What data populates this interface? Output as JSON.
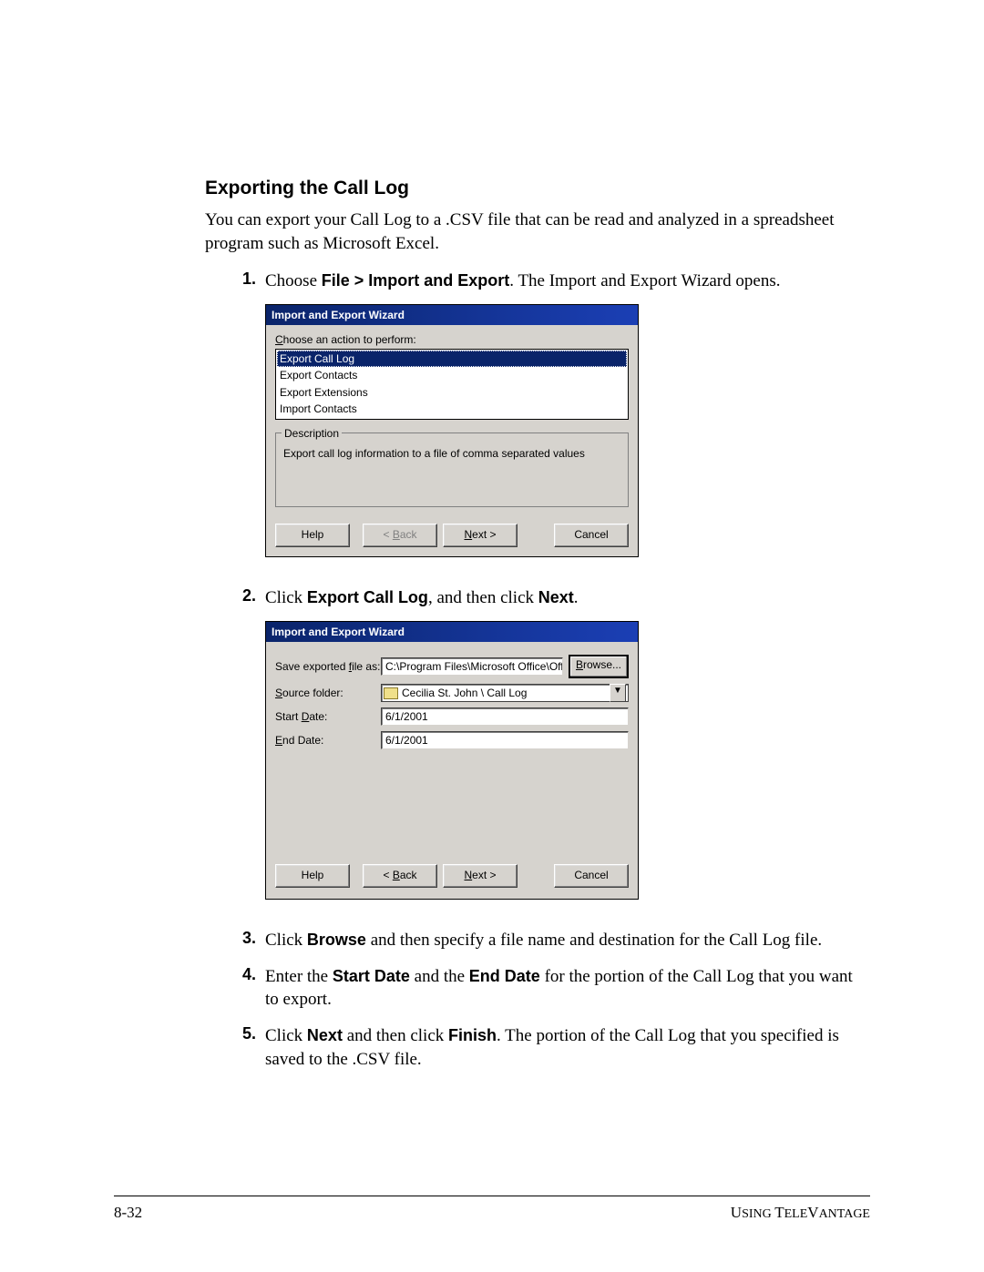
{
  "heading": "Exporting the Call Log",
  "intro": "You can export your Call Log to a .CSV file that can be read and analyzed in a spreadsheet program such as Microsoft Excel.",
  "steps": {
    "s1": {
      "num": "1.",
      "pre": "Choose ",
      "bold1": "File > Import and Export",
      "post1": ". The Import and Export Wizard opens."
    },
    "s2": {
      "num": "2.",
      "pre": "Click ",
      "bold1": "Export Call Log",
      "mid": ", and then click ",
      "bold2": "Next",
      "post": "."
    },
    "s3": {
      "num": "3.",
      "pre": "Click ",
      "bold1": "Browse",
      "post": " and then specify a file name and destination for the Call Log file."
    },
    "s4": {
      "num": "4.",
      "pre": "Enter the ",
      "bold1": "Start Date",
      "mid": " and the ",
      "bold2": "End Date",
      "post": " for the portion of the Call Log that you want to export."
    },
    "s5": {
      "num": "5.",
      "pre": "Click ",
      "bold1": "Next",
      "mid": " and then click ",
      "bold2": "Finish",
      "post": ". The portion of the Call Log that you specified is saved to the .CSV file."
    }
  },
  "dialog1": {
    "title": "Import and Export Wizard",
    "prompt": "Choose an action to perform:",
    "items": [
      "Export Call Log",
      "Export Contacts",
      "Export Extensions",
      "Import Contacts"
    ],
    "desc_legend": "Description",
    "desc_text": "Export call log information to a file of comma separated values",
    "btn_help": "Help",
    "btn_back": "< Back",
    "btn_next": "Next >",
    "btn_cancel": "Cancel",
    "next_ul": "N",
    "back_ul": "B"
  },
  "dialog2": {
    "title": "Import and Export Wizard",
    "lab_saveas": "Save exported file as:",
    "val_saveas": "C:\\Program Files\\Microsoft Office\\Office\\Call:",
    "btn_browse": "Browse...",
    "browse_ul": "B",
    "lab_source": "Source folder:",
    "val_source": "Cecilia St. John \\ Call Log",
    "source_ul": "S",
    "lab_start": "Start Date:",
    "val_start": "6/1/2001",
    "start_ul": "D",
    "lab_end": "End Date:",
    "val_end": "6/1/2001",
    "end_ul": "E",
    "btn_help": "Help",
    "btn_back": "< Back",
    "btn_next": "Next >",
    "btn_cancel": "Cancel",
    "next_ul": "N",
    "back_ul": "B",
    "saveas_ul": "f"
  },
  "footer": {
    "left": "8-32",
    "right_pre": "U",
    "right_rest": "SING ",
    "right_pre2": "T",
    "right_rest2": "ELE",
    "right_pre3": "V",
    "right_rest3": "ANTAGE"
  }
}
